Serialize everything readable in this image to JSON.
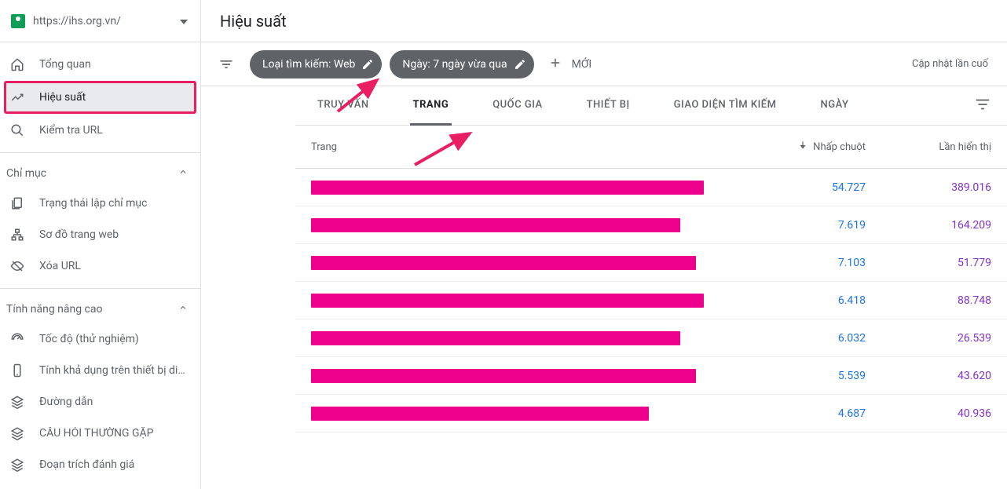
{
  "site": {
    "url": "https://ihs.org.vn/"
  },
  "sidebar": {
    "nav_primary": [
      {
        "label": "Tổng quan",
        "icon": "home"
      },
      {
        "label": "Hiệu suất",
        "icon": "trend"
      },
      {
        "label": "Kiểm tra URL",
        "icon": "search"
      }
    ],
    "section_index_header": "Chỉ mục",
    "nav_index": [
      {
        "label": "Trạng thái lập chỉ mục",
        "icon": "coverage"
      },
      {
        "label": "Sơ đồ trang web",
        "icon": "sitemap"
      },
      {
        "label": "Xóa URL",
        "icon": "removals"
      }
    ],
    "section_enh_header": "Tính năng nâng cao",
    "nav_enh": [
      {
        "label": "Tốc độ (thử nghiệm)",
        "icon": "speed"
      },
      {
        "label": "Tính khả dụng trên thiết bị di …",
        "icon": "mobile"
      },
      {
        "label": "Đường dẫn",
        "icon": "layers"
      },
      {
        "label": "CÂU HỎI THƯỜNG GẶP",
        "icon": "layers"
      },
      {
        "label": "Đoạn trích đánh giá",
        "icon": "layers"
      }
    ]
  },
  "header": {
    "title": "Hiệu suất"
  },
  "filters": {
    "search_type_chip": "Loại tìm kiếm: Web",
    "date_chip": "Ngày: 7 ngày vừa qua",
    "new_label": "MỚI",
    "last_updated": "Cập nhật lần cuố"
  },
  "tabs": {
    "items": [
      "TRUY VẤN",
      "TRANG",
      "QUỐC GIA",
      "THIẾT BỊ",
      "GIAO DIỆN TÌM KIẾM",
      "NGÀY"
    ],
    "active_index": 1
  },
  "table": {
    "columns": {
      "page": "Trang",
      "clicks": "Nhấp chuột",
      "impressions": "Lần hiển thị"
    },
    "rows": [
      {
        "redact_width": 500,
        "clicks": "54.727",
        "impressions": "389.016"
      },
      {
        "redact_width": 470,
        "clicks": "7.619",
        "impressions": "164.209"
      },
      {
        "redact_width": 490,
        "clicks": "7.103",
        "impressions": "51.779"
      },
      {
        "redact_width": 500,
        "clicks": "6.418",
        "impressions": "88.748"
      },
      {
        "redact_width": 470,
        "clicks": "6.032",
        "impressions": "26.539"
      },
      {
        "redact_width": 490,
        "clicks": "5.539",
        "impressions": "43.620"
      },
      {
        "redact_width": 430,
        "clicks": "4.687",
        "impressions": "40.936"
      }
    ]
  }
}
